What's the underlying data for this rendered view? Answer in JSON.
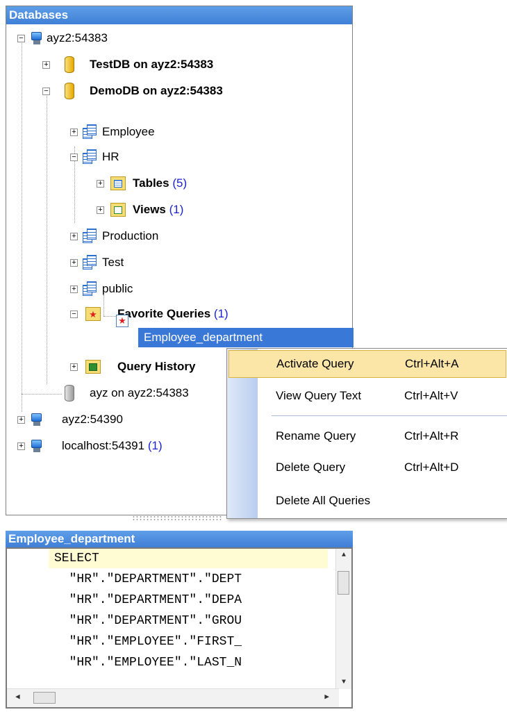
{
  "databases_panel": {
    "title": "Databases",
    "tree": [
      {
        "label": "ayz2:54383",
        "count": ""
      },
      {
        "label": "TestDB on ayz2:54383",
        "count": ""
      },
      {
        "label": "DemoDB on ayz2:54383",
        "count": ""
      },
      {
        "label": "Employee",
        "count": ""
      },
      {
        "label": "HR",
        "count": ""
      },
      {
        "label": "Tables",
        "count": "(5)"
      },
      {
        "label": "Views",
        "count": "(1)"
      },
      {
        "label": "Production",
        "count": ""
      },
      {
        "label": "Test",
        "count": ""
      },
      {
        "label": "public",
        "count": ""
      },
      {
        "label": "Favorite Queries",
        "count": "(1)"
      },
      {
        "label": "Employee_department",
        "count": ""
      },
      {
        "label": "Query History",
        "count": ""
      },
      {
        "label": "ayz on ayz2:54383",
        "count": ""
      },
      {
        "label": "ayz2:54390",
        "count": ""
      },
      {
        "label": "localhost:54391",
        "count": "(1)"
      }
    ]
  },
  "context_menu": {
    "items": [
      {
        "label": "Activate Query",
        "shortcut": "Ctrl+Alt+A"
      },
      {
        "label": "View Query Text",
        "shortcut": "Ctrl+Alt+V"
      },
      {
        "label": "Rename Query",
        "shortcut": "Ctrl+Alt+R"
      },
      {
        "label": "Delete Query",
        "shortcut": "Ctrl+Alt+D"
      },
      {
        "label": "Delete All Queries",
        "shortcut": ""
      }
    ]
  },
  "sql_panel": {
    "title": "Employee_department",
    "lines": [
      "SELECT",
      "  \"HR\".\"DEPARTMENT\".\"DEPT",
      "  \"HR\".\"DEPARTMENT\".\"DEPA",
      "  \"HR\".\"DEPARTMENT\".\"GROU",
      "  \"HR\".\"EMPLOYEE\".\"FIRST_",
      "  \"HR\".\"EMPLOYEE\".\"LAST_N"
    ]
  },
  "colors": {
    "title_bar": "#3f7fd6",
    "selection": "#3a78d8",
    "menu_highlight": "#fbe6a8",
    "count_text": "#1a22d6"
  }
}
